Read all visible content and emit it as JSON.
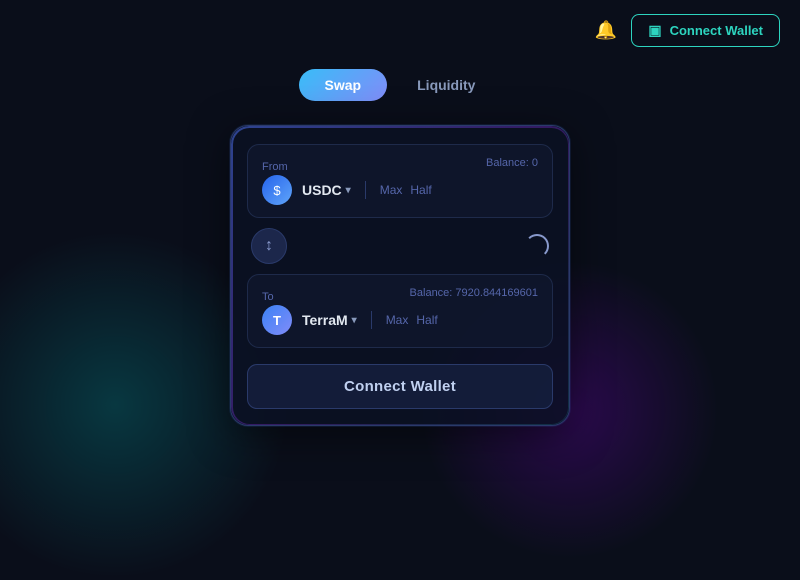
{
  "header": {
    "connect_wallet_label": "Connect Wallet",
    "bell_icon": "🔔",
    "wallet_icon": "▣"
  },
  "tabs": {
    "swap_label": "Swap",
    "liquidity_label": "Liquidity",
    "active": "swap"
  },
  "card": {
    "from_panel": {
      "label": "From",
      "balance_label": "Balance: 0",
      "token_symbol": "USDC",
      "token_icon": "$",
      "max_label": "Max",
      "half_label": "Half"
    },
    "to_panel": {
      "label": "To",
      "balance_label": "Balance: 7920.844169601",
      "token_symbol": "TerraM",
      "token_icon": "T",
      "max_label": "Max",
      "half_label": "Half"
    },
    "swap_arrow": "↕",
    "connect_wallet_label": "Connect Wallet"
  },
  "colors": {
    "accent_teal": "#2dd4bf",
    "accent_blue": "#38bdf8",
    "accent_purple": "#818cf8"
  }
}
